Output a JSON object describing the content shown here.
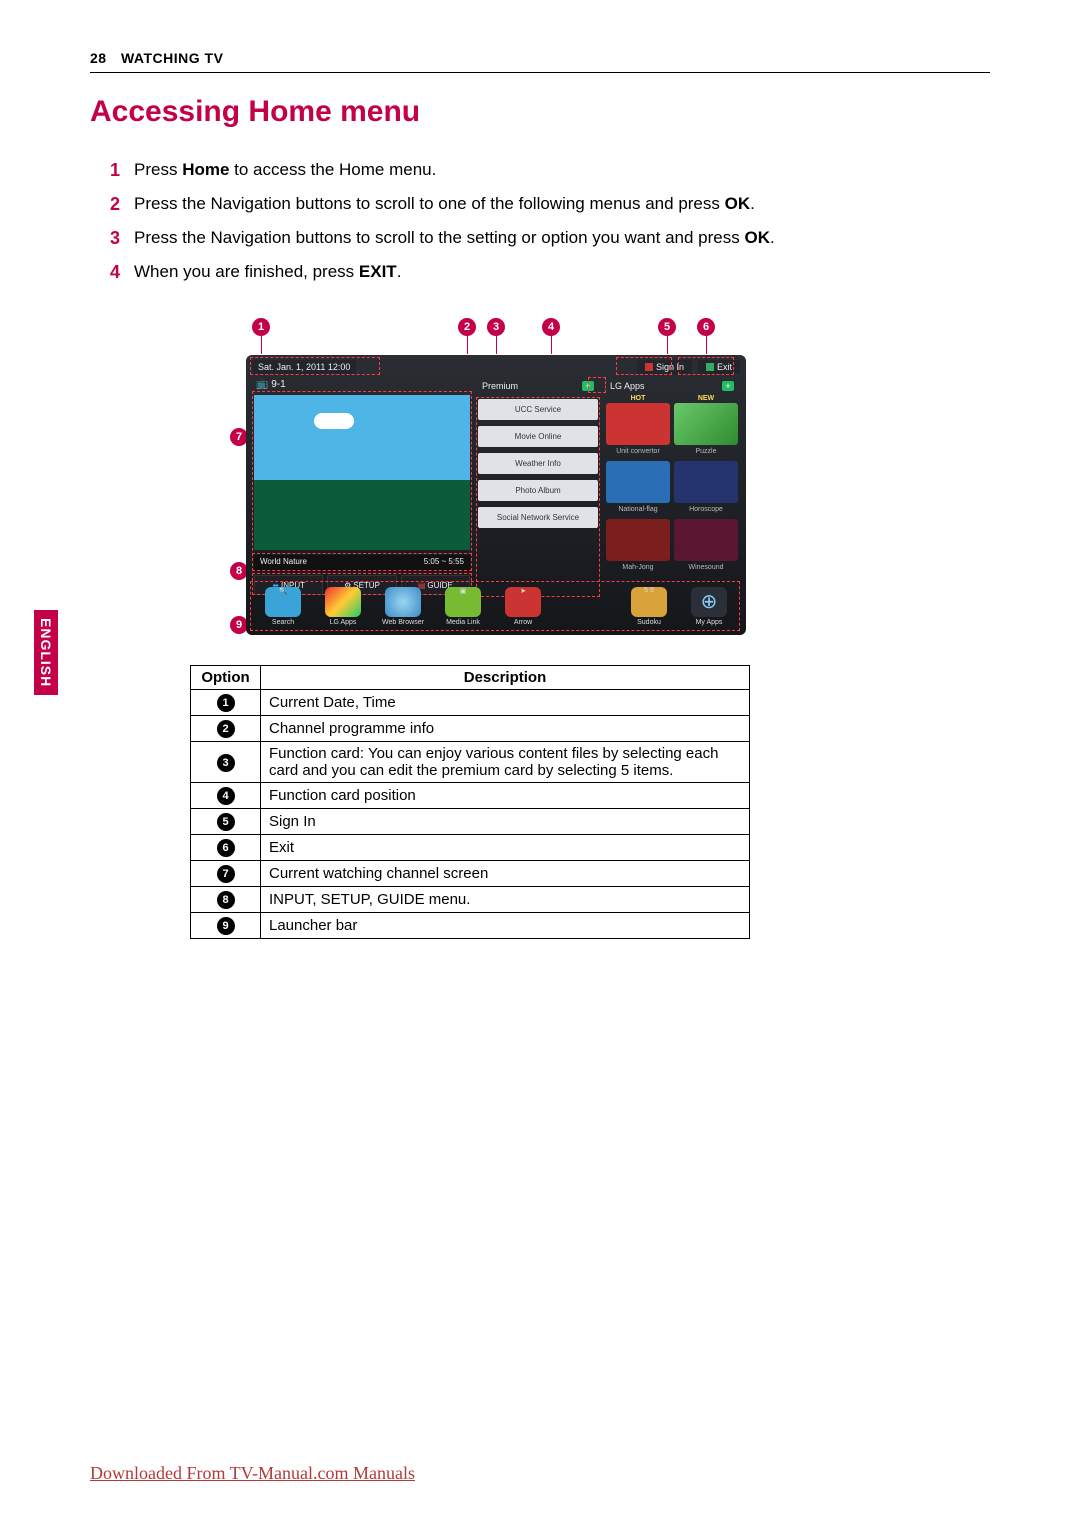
{
  "header": {
    "page_number": "28",
    "section": "WATCHING TV"
  },
  "language_tab": "ENGLISH",
  "title": "Accessing Home menu",
  "steps": [
    {
      "n": "1",
      "pre": "Press ",
      "b": "Home",
      "post": " to access the Home menu."
    },
    {
      "n": "2",
      "pre": "Press the Navigation buttons to scroll to one of the following menus and press ",
      "b": "OK",
      "post": "."
    },
    {
      "n": "3",
      "pre": "Press the Navigation buttons to scroll to the setting or option you want and press ",
      "b": "OK",
      "post": "."
    },
    {
      "n": "4",
      "pre": "When you are finished, press ",
      "b": "EXIT",
      "post": "."
    }
  ],
  "callouts_top": [
    "1",
    "2",
    "3",
    "4",
    "5",
    "6"
  ],
  "callouts_side": [
    "7",
    "8",
    "9"
  ],
  "screenshot": {
    "datetime": "Sat. Jan. 1, 2011  12:00",
    "channel": "9-1",
    "sign_in": "Sign In",
    "exit": "Exit",
    "program_name": "World Nature",
    "program_time": "5:05 ~ 5:55",
    "buttons": {
      "input": "INPUT",
      "setup": "SETUP",
      "guide": "GUIDE"
    },
    "premium": {
      "label": "Premium",
      "items": [
        "UCC Service",
        "Movie Online",
        "Weather Info",
        "Photo Album",
        "Social Network Service"
      ]
    },
    "lgapps": {
      "label": "LG Apps",
      "badges": [
        "HOT",
        "NEW"
      ],
      "apps": [
        "Unit convertor",
        "Puzzle",
        "National-flag",
        "Horoscope",
        "Mah-Jong",
        "Winesound"
      ]
    },
    "launcher": [
      {
        "name": "Search"
      },
      {
        "name": "LG Apps"
      },
      {
        "name": "Web Browser"
      },
      {
        "name": "Media Link"
      },
      {
        "name": "Arrow"
      },
      {
        "name": "Sudoku"
      },
      {
        "name": "My Apps"
      }
    ]
  },
  "table": {
    "head_option": "Option",
    "head_desc": "Description",
    "rows": [
      {
        "n": "1",
        "desc": "Current Date, Time"
      },
      {
        "n": "2",
        "desc": "Channel programme info"
      },
      {
        "n": "3",
        "desc": "Function card: You can enjoy various content files by selecting each card and you can edit the premium card by selecting 5 items."
      },
      {
        "n": "4",
        "desc": "Function card position"
      },
      {
        "n": "5",
        "desc": "Sign In"
      },
      {
        "n": "6",
        "desc": "Exit"
      },
      {
        "n": "7",
        "desc": "Current watching channel screen"
      },
      {
        "n": "8",
        "desc": "INPUT, SETUP, GUIDE menu."
      },
      {
        "n": "9",
        "desc": "Launcher bar"
      }
    ]
  },
  "footer": "Downloaded From TV-Manual.com Manuals"
}
